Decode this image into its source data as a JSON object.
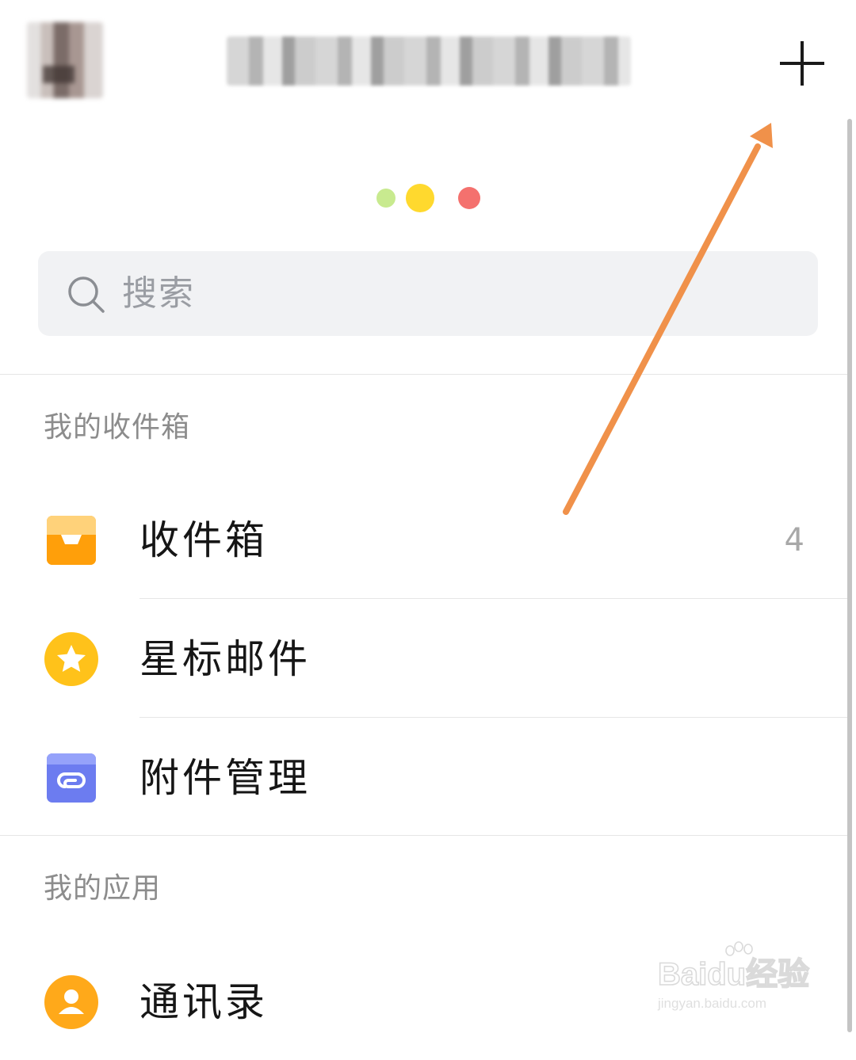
{
  "header": {
    "account_name": "",
    "add_icon": "plus-icon"
  },
  "search": {
    "placeholder": "搜索",
    "icon": "search-icon"
  },
  "sections": [
    {
      "title": "我的收件箱",
      "items": [
        {
          "label": "收件箱",
          "count": "4",
          "icon": "inbox-tray-icon",
          "color": "#FFB02E"
        },
        {
          "label": "星标邮件",
          "count": "",
          "icon": "star-icon",
          "color": "#FFC21A"
        },
        {
          "label": "附件管理",
          "count": "",
          "icon": "attachment-link-icon",
          "color": "#6C7CF0"
        }
      ]
    },
    {
      "title": "我的应用",
      "items": [
        {
          "label": "通讯录",
          "count": "",
          "icon": "contacts-person-icon",
          "color": "#FFA91A"
        }
      ]
    }
  ],
  "watermark": {
    "brand": "Baidu经验",
    "url": "jingyan.baidu.com"
  },
  "colors": {
    "annotation_arrow": "#F0914A",
    "dot_green": "#C8EA8F",
    "dot_yellow": "#FFD92E",
    "dot_red": "#F4716E"
  }
}
